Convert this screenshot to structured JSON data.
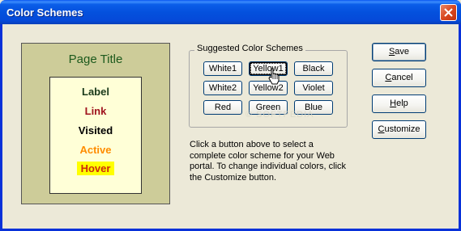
{
  "window": {
    "title": "Color Schemes"
  },
  "preview": {
    "title": "Page Title",
    "label": "Label",
    "link": "Link",
    "visited": "Visited",
    "active": "Active",
    "hover": "Hover"
  },
  "schemes": {
    "group_label": "Suggested Color Schemes",
    "buttons": [
      "White1",
      "Yellow1",
      "Black",
      "White2",
      "Yellow2",
      "Violet",
      "Red",
      "Green",
      "Blue"
    ],
    "selected": "Yellow1"
  },
  "description": "Click a button above to select a complete color scheme for your Web portal.  To change individual colors, click the Customize button.",
  "actions": {
    "save_pre": "",
    "save_ul": "S",
    "save_post": "ave",
    "cancel_ul": "C",
    "cancel_post": "ancel",
    "help_ul": "H",
    "help_post": "elp",
    "customize_ul": "C",
    "customize_post": "ustomize"
  },
  "watermark": "© SOFTPEDIA",
  "colors": {
    "titlebar": "#0451dd",
    "preview_bg": "#cdcc99",
    "preview_inner_bg": "#ffffd7",
    "title_color": "#1d5a1d",
    "link_color": "#a0141e",
    "active_color": "#ff8c00",
    "hover_bg": "#ffff00"
  }
}
